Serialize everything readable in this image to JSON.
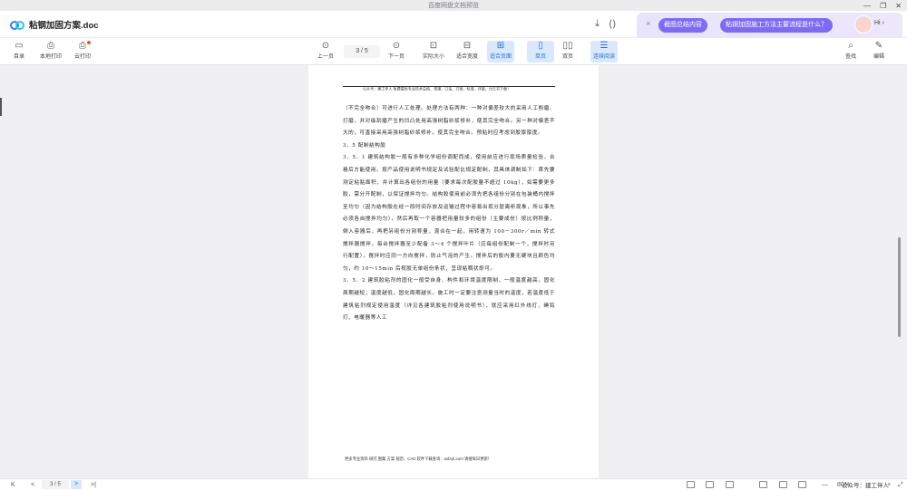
{
  "window": {
    "title": "百度网盘文档预览",
    "controls": [
      "—",
      "❐",
      "✕"
    ]
  },
  "header": {
    "doc_title": "粘钢加固方案.doc"
  },
  "ai": {
    "close": "×",
    "chip1": "截图总结内容",
    "chip2": "粘钢加固施工方法主要流程是什么？",
    "hi": "Hi ›"
  },
  "toolbar": {
    "toc": "目录",
    "local_print": "本地打印",
    "cloud_print": "云打印",
    "prev": "上一页",
    "page_indicator": "3 / 5",
    "next": "下一页",
    "actual_size": "实际大小",
    "fit_width": "适合宽度",
    "fit_page": "适合页面",
    "single": "单页",
    "double": "双页",
    "continuous": "连续阅读",
    "search": "查找",
    "edit": "编辑"
  },
  "document": {
    "header_text": "公众号：建工伴人  免费提供专业技术总结、常漫、口诀、方案、标准、评能、计正书下载！",
    "paragraphs": [
      "（不完全吻合）可进行人工处理。处理方法有两种：一种对偏差较大的采用人工削磨、打磨，并对级刮磨产生的凹凸处用高强树脂砂浆修补，使其完全吻合。另一种对偏差不大的，可直接采用高强树脂砂浆修补，使其完全吻合。预贴时应考虑到胶厚厚度。",
      "3．5 配制结构胶",
      "3．5．1 建筑结构胶一般有多种化学组份调配而成，使用前应进行现场质量检验，合格后方能使用。按产品使用说明书规定及试验配比规定配制，其具体调制如下：首先要测定粘贴面积，并计算出各组份的用量（要求每次配胶量不超过 10kg），如需要更多胶，需分开配制，以保证搅拌均匀。结构胶使用前必须先把各组份分别在包装桶内搅拌至均匀（因为结构胶在经一段时间存放及运输过程中容易出现分层离析现象，所以事先必须各自搅拌均匀），然后再取一个容器把用量较多的组份（主要成份）按比例称量，倒入容器后，再把另组份分别称量，混合在一起，用转速为 100－300r／min 转式搅拌器搅拌，每台搅拌器至少配备 3～4 个搅拌叶片（应每组份配制一个，搅拌时另行配置），搅拌时应同一方向搅拌，防止气泡的产生。搅拌后的胶内要无硬块且颜色均匀，约 10～15min 后视胶无单组份条状，呈现粘稠状即可。",
      "3．5．2 建筑胶粘剂的固化一般受自身、构件和环境温度限制，一般温度越高，固化周期越短；温度越低，固化周期越长。施工时一定要注意测量当时的温度，若温度低于建筑粘剂规定使用温度（详见各建筑胶粘剂使用说明书），就应采用红外线灯、碘钨灯、电暖器等人工"
    ],
    "footer_text": "更多专业资料 研究 图集 方案 规范、CAD 软件下载查询：wdzyk.com 请搜每日更新！"
  },
  "status": {
    "first": "K",
    "prev": "<",
    "page": "3 / 5",
    "next": ">",
    "last": ">|",
    "zoom_minus": "—",
    "zoom": "80%",
    "zoom_plus": "+",
    "expand": "⤢"
  },
  "watermark": "公众号：建工伴人"
}
